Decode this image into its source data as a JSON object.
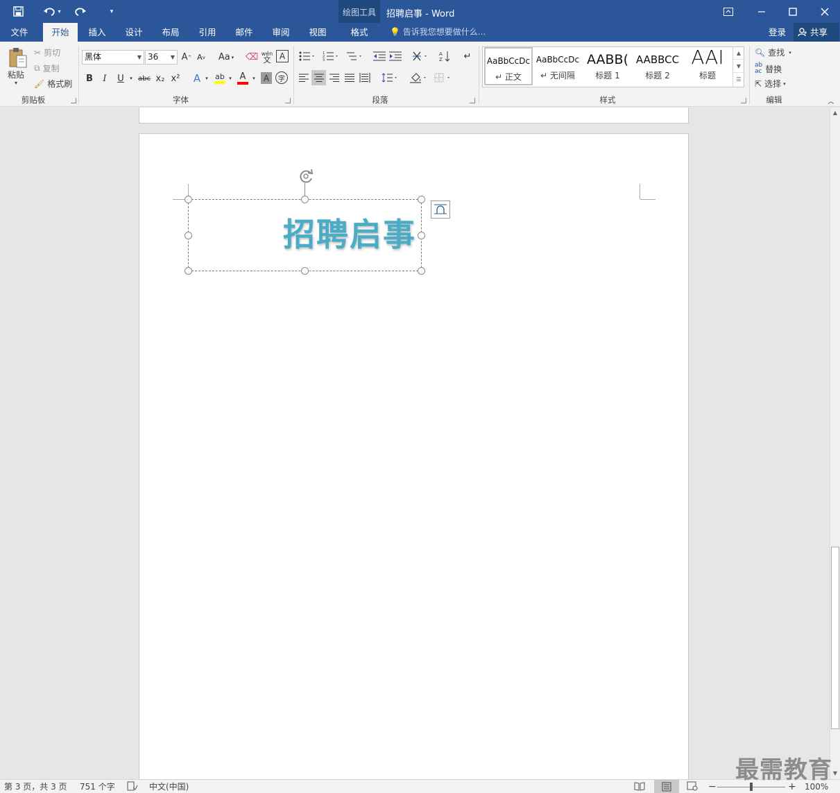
{
  "window": {
    "document_title": "招聘启事 - Word",
    "context_tab_group": "绘图工具"
  },
  "ribbon_tabs": [
    {
      "label": "文件"
    },
    {
      "label": "开始",
      "active": true
    },
    {
      "label": "插入"
    },
    {
      "label": "设计"
    },
    {
      "label": "布局"
    },
    {
      "label": "引用"
    },
    {
      "label": "邮件"
    },
    {
      "label": "审阅"
    },
    {
      "label": "视图"
    },
    {
      "label": "格式"
    }
  ],
  "tell_me": "告诉我您想要做什么...",
  "account": {
    "login": "登录",
    "share": "共享"
  },
  "clipboard": {
    "paste": "粘贴",
    "cut": "剪切",
    "copy": "复制",
    "format_painter": "格式刷",
    "group_label": "剪贴板"
  },
  "font": {
    "font_name": "黑体",
    "font_size": "36",
    "group_label": "字体",
    "grow": "A",
    "shrink": "A",
    "change_case": "Aa",
    "phonetic": "wén",
    "border_char": "A",
    "bold": "B",
    "italic": "I",
    "underline": "U",
    "strike": "abc",
    "subscript": "x₂",
    "superscript": "x²",
    "text_effect": "A",
    "highlight": "ab",
    "font_color": "A",
    "char_shading": "A",
    "enclose": "字",
    "highlight_color": "#ffff00",
    "font_color_value": "#ff0000"
  },
  "paragraph": {
    "group_label": "段落"
  },
  "styles": {
    "group_label": "样式",
    "items": [
      {
        "sample": "AaBbCcDc",
        "name": "↵ 正文"
      },
      {
        "sample": "AaBbCcDc",
        "name": "↵ 无间隔"
      },
      {
        "sample": "AABB(",
        "name": "标题 1"
      },
      {
        "sample": "AABBCC",
        "name": "标题 2"
      },
      {
        "sample": "AAI",
        "name": "标题"
      }
    ]
  },
  "editing": {
    "group_label": "编辑",
    "find": "查找",
    "replace": "替换",
    "select": "选择"
  },
  "document": {
    "headline": "招聘启事",
    "headline_color": "#4bacc6"
  },
  "status": {
    "page": "第 3 页，共 3 页",
    "words": "751 个字",
    "language": "中文(中国)",
    "zoom": "100%"
  },
  "watermark": "最需教育",
  "colors": {
    "brand": "#2b579a",
    "ribbon_bg": "#f3f3f3"
  }
}
